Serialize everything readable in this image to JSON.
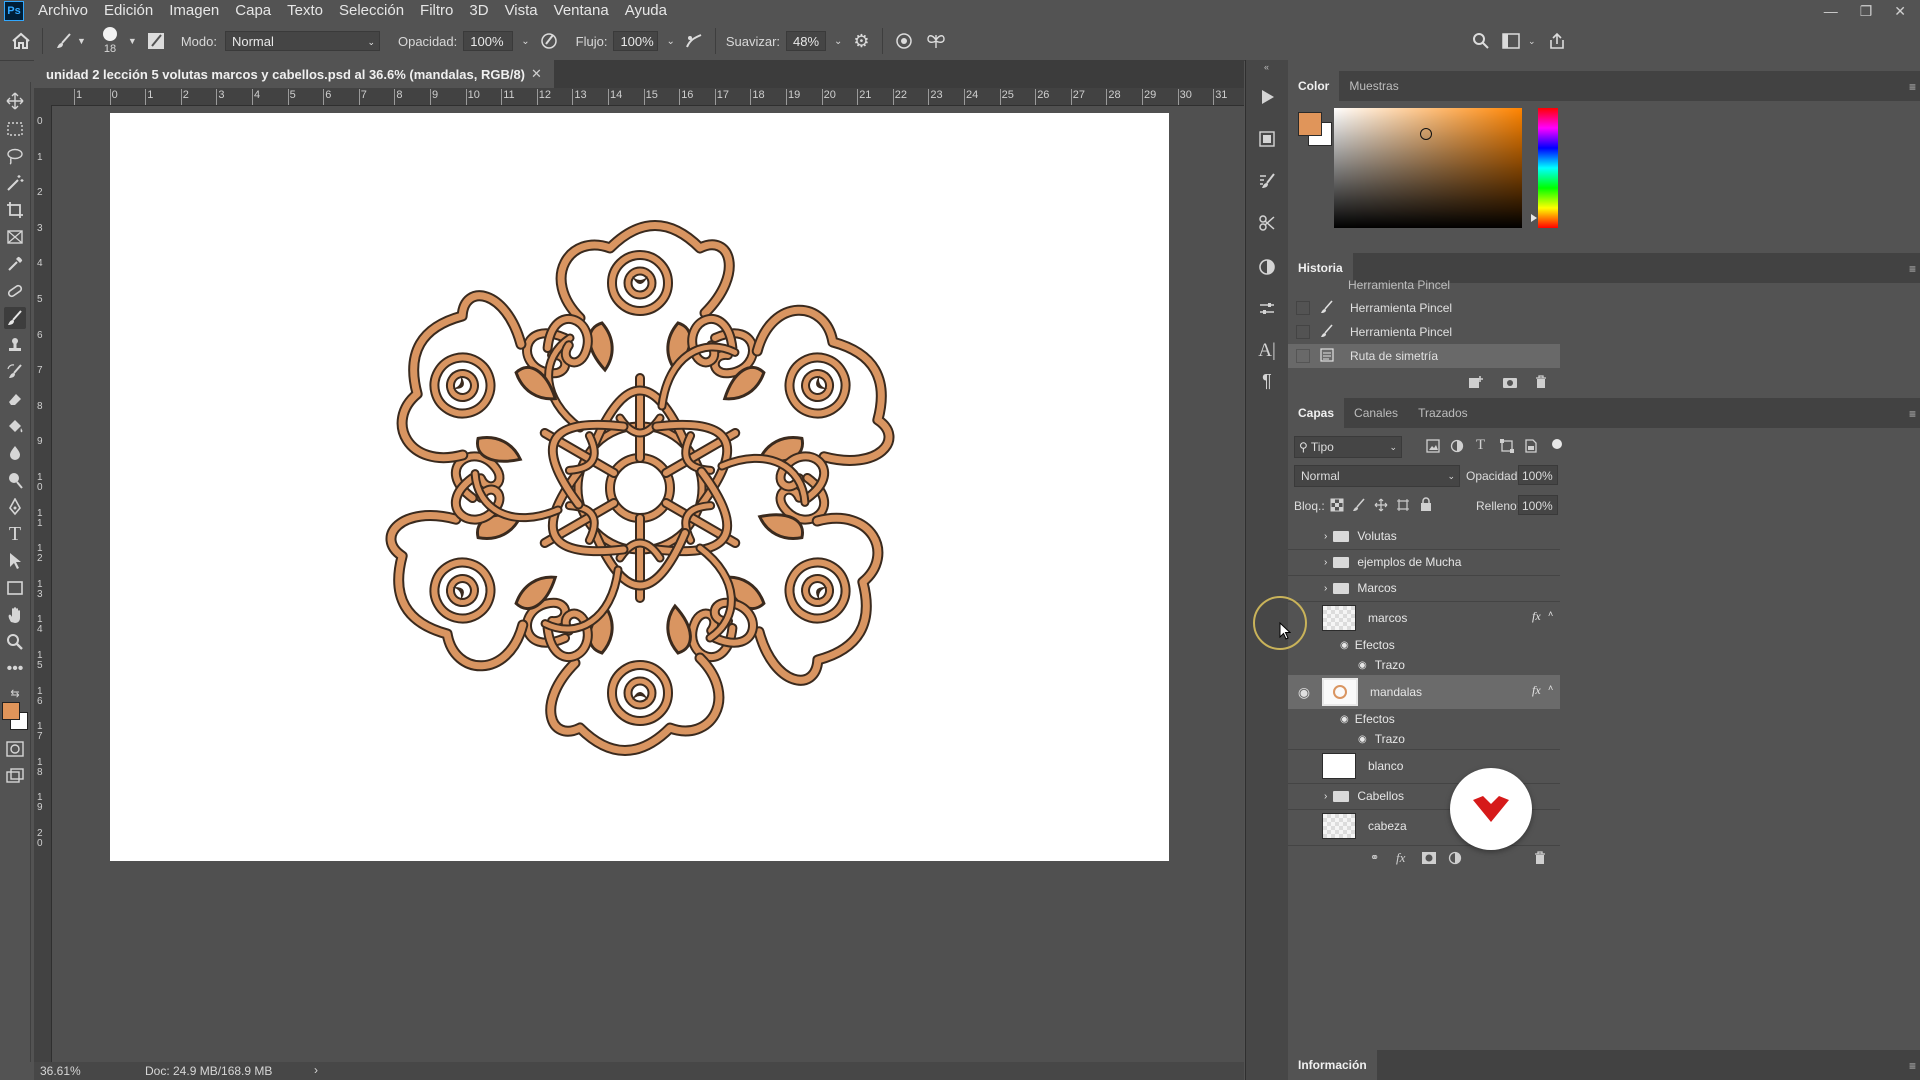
{
  "menu": {
    "items": [
      "Archivo",
      "Edición",
      "Imagen",
      "Capa",
      "Texto",
      "Selección",
      "Filtro",
      "3D",
      "Vista",
      "Ventana",
      "Ayuda"
    ]
  },
  "options": {
    "brush_size": "18",
    "mode_label": "Modo:",
    "mode_value": "Normal",
    "opacity_label": "Opacidad:",
    "opacity_value": "100%",
    "flow_label": "Flujo:",
    "flow_value": "100%",
    "smooth_label": "Suavizar:",
    "smooth_value": "48%"
  },
  "document": {
    "tab_title": "unidad 2 lección 5 volutas marcos y cabellos.psd al 36.6% (mandalas, RGB/8)",
    "zoom": "36.61%",
    "doc_size": "Doc: 24.9 MB/168.9 MB",
    "ruler_top": [
      "1",
      "0",
      "1",
      "2",
      "3",
      "4",
      "5",
      "6",
      "7",
      "8",
      "9",
      "10",
      "11",
      "12",
      "13",
      "14",
      "15",
      "16",
      "17",
      "18",
      "19",
      "20",
      "21",
      "22",
      "23",
      "24",
      "25",
      "26",
      "27",
      "28",
      "29",
      "30",
      "31"
    ],
    "ruler_left": [
      "0",
      "1",
      "2",
      "3",
      "4",
      "5",
      "6",
      "7",
      "8",
      "9",
      "10",
      "11",
      "12",
      "13",
      "14",
      "15",
      "16",
      "17",
      "18",
      "19",
      "20"
    ]
  },
  "colors": {
    "foreground": "#e0955a",
    "background": "#ffffff",
    "mandala_fill": "#d99561",
    "mandala_stroke": "#3a2a1e"
  },
  "color_panel": {
    "tabs": [
      "Color",
      "Muestras"
    ]
  },
  "history": {
    "title": "Historia",
    "cut_item": "Herramienta Pincel",
    "items": [
      "Herramienta Pincel",
      "Herramienta Pincel",
      "Ruta de simetría"
    ]
  },
  "layers": {
    "tabs": [
      "Capas",
      "Canales",
      "Trazados"
    ],
    "filter_kind": "Tipo",
    "blend_mode": "Normal",
    "opacity_label": "Opacidad:",
    "opacity_value": "100%",
    "lock_label": "Bloq.:",
    "fill_label": "Relleno:",
    "fill_value": "100%",
    "list": [
      {
        "name": "Volutas",
        "type": "group"
      },
      {
        "name": "ejemplos de Mucha",
        "type": "group"
      },
      {
        "name": "Marcos",
        "type": "group"
      },
      {
        "name": "marcos",
        "type": "layer",
        "fx": true,
        "effects": "Efectos",
        "trazo": "Trazo"
      },
      {
        "name": "mandalas",
        "type": "layer",
        "fx": true,
        "visible": true,
        "selected": true,
        "effects": "Efectos",
        "trazo": "Trazo"
      },
      {
        "name": "blanco",
        "type": "layer"
      },
      {
        "name": "Cabellos",
        "type": "group"
      },
      {
        "name": "cabeza",
        "type": "layer"
      }
    ]
  },
  "info_panel": {
    "title": "Información"
  }
}
